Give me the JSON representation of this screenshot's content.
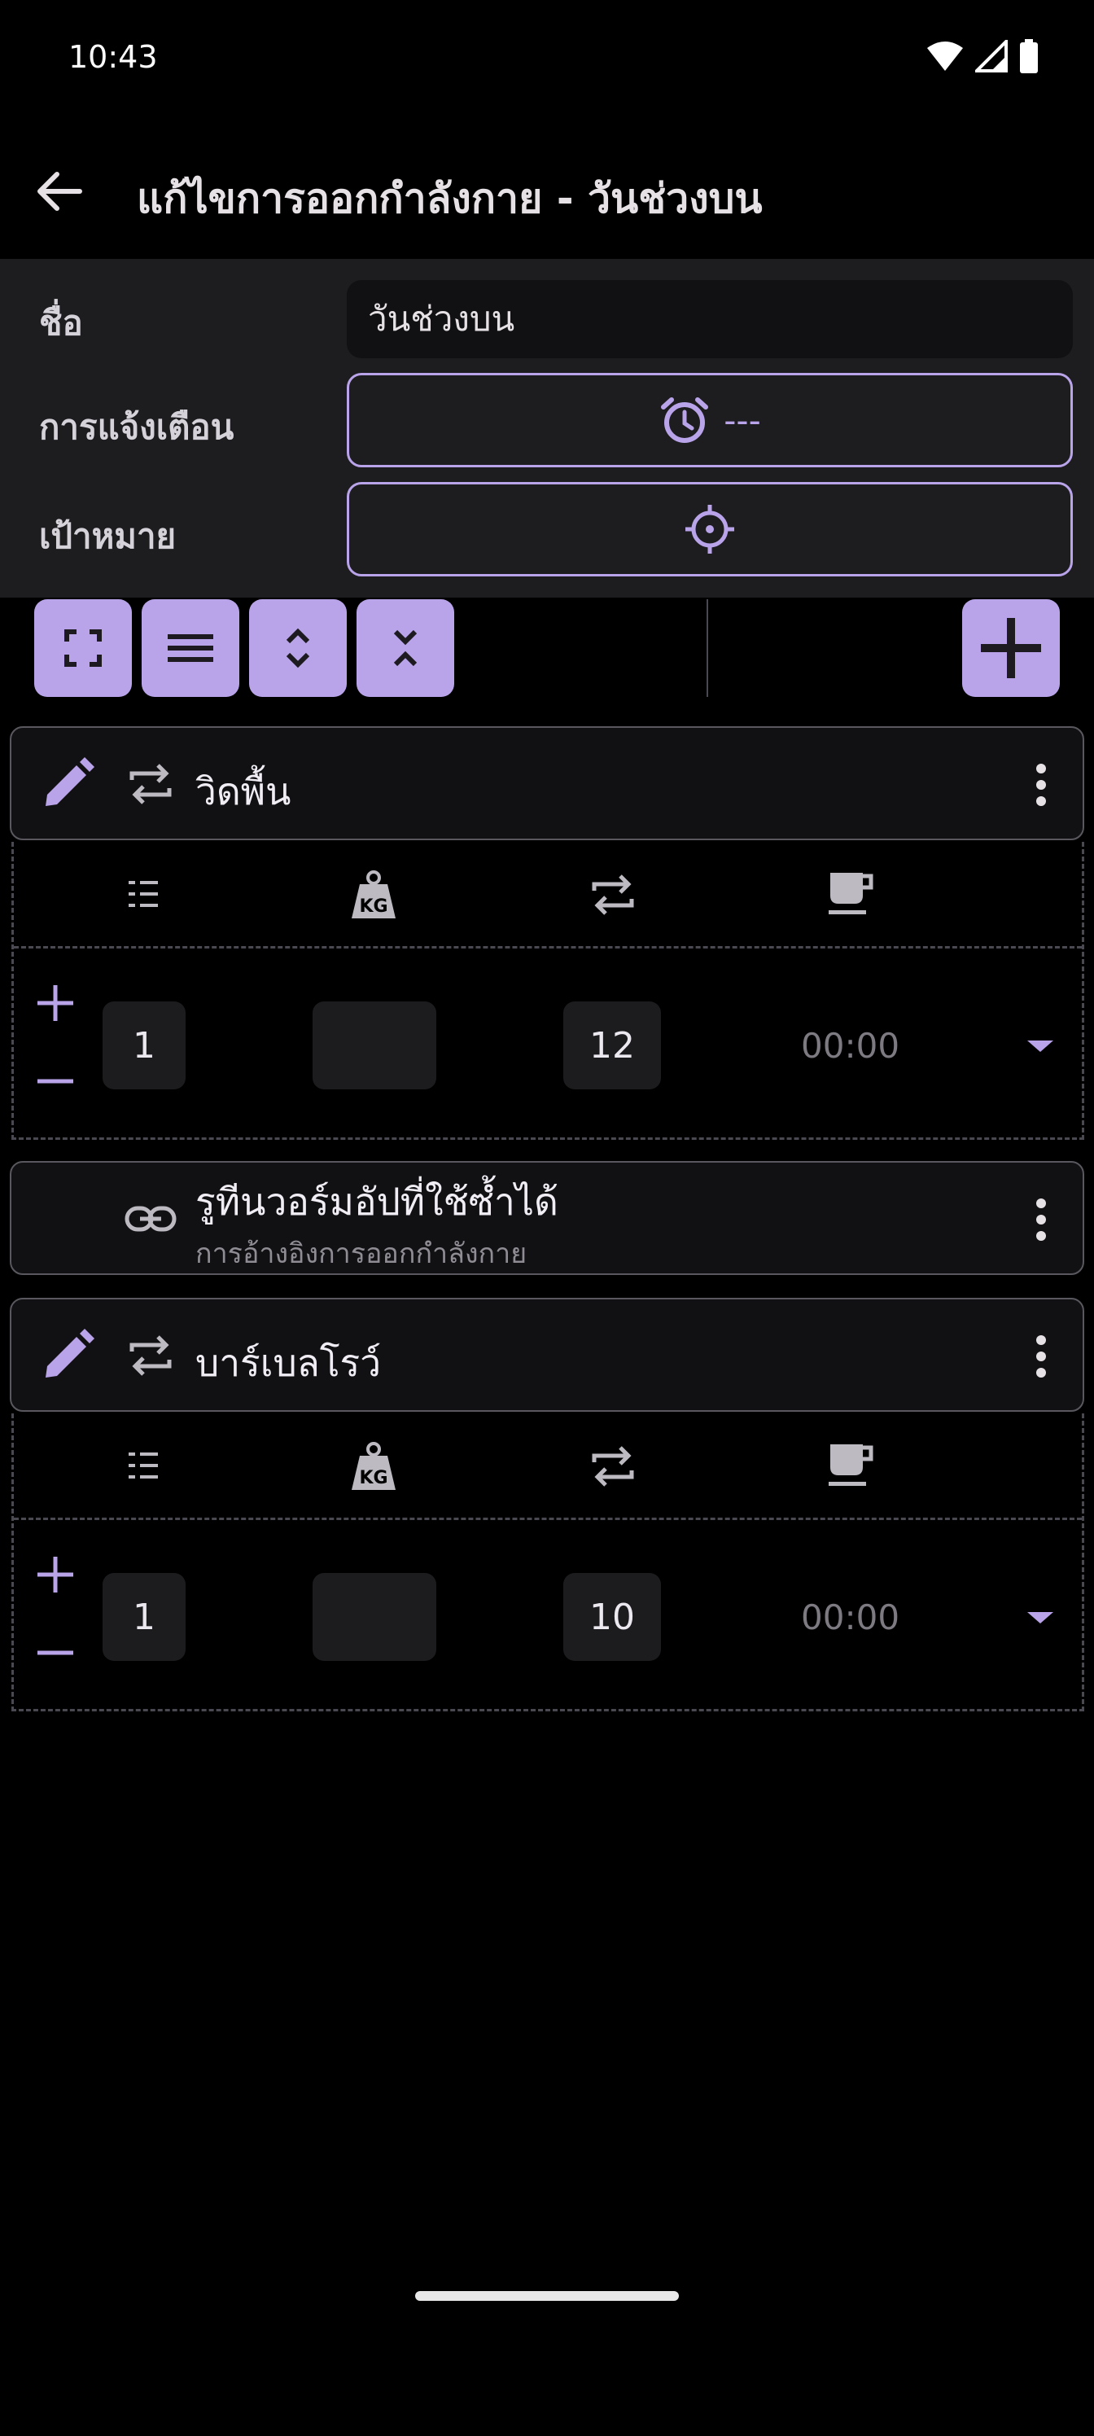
{
  "status": {
    "time": "10:43"
  },
  "app_bar": {
    "title": "แก้ไขการออกกำลังกาย - วันช่วงบน"
  },
  "form": {
    "name_label": "ชื่อ",
    "name_value": "วันช่วงบน",
    "reminder_label": "การแจ้งเตือน",
    "reminder_value": "---",
    "target_label": "เป้าหมาย"
  },
  "toolbar": {
    "buttons": [
      "fullscreen-icon",
      "reorder-icon",
      "expand-icon",
      "collapse-icon"
    ],
    "add_icon": "plus-icon"
  },
  "exercises": [
    {
      "name": "วิดพื้น",
      "headers": [
        "list-icon",
        "weight-kg-icon",
        "repeat-icon",
        "coffee-cup-icon"
      ],
      "sets": [
        {
          "set": "1",
          "weight": "",
          "reps": "12",
          "rest": "00:00"
        }
      ]
    },
    {
      "name": "บาร์เบลโรว์",
      "headers": [
        "list-icon",
        "weight-kg-icon",
        "repeat-icon",
        "coffee-cup-icon"
      ],
      "sets": [
        {
          "set": "1",
          "weight": "",
          "reps": "10",
          "rest": "00:00"
        }
      ]
    }
  ],
  "reference": {
    "title": "รูทีนวอร์มอัปที่ใช้ซ้ำได้",
    "subtitle": "การอ้างอิงการออกกำลังกาย"
  },
  "colors": {
    "accent": "#b9a4ea",
    "background": "#000000",
    "panel": "#1d1c1f"
  }
}
